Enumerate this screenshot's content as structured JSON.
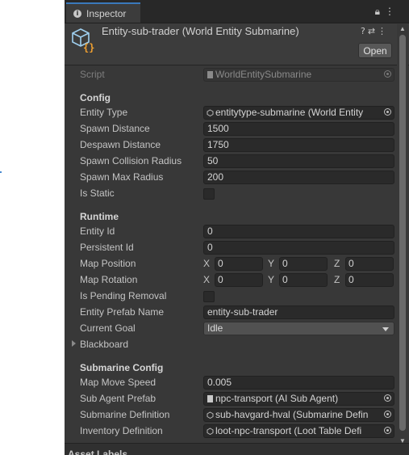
{
  "tab": {
    "label": "Inspector",
    "tools": "🔒 ⋮"
  },
  "header": {
    "title": "Entity-sub-trader (World Entity Submarine)",
    "icons": "❓ ⇄ ⋮",
    "open_button": "Open"
  },
  "script_row": {
    "label": "Script",
    "value": "WorldEntitySubmarine"
  },
  "config": {
    "section": "Config",
    "entity_type": {
      "label": "Entity Type",
      "value": "entitytype-submarine (World Entity"
    },
    "spawn_distance": {
      "label": "Spawn Distance",
      "value": "1500"
    },
    "despawn_distance": {
      "label": "Despawn Distance",
      "value": "1750"
    },
    "spawn_collision_radius": {
      "label": "Spawn Collision Radius",
      "value": "50"
    },
    "spawn_max_radius": {
      "label": "Spawn Max Radius",
      "value": "200"
    },
    "is_static": {
      "label": "Is Static",
      "checked": false
    }
  },
  "runtime": {
    "section": "Runtime",
    "entity_id": {
      "label": "Entity Id",
      "value": "0"
    },
    "persistent_id": {
      "label": "Persistent Id",
      "value": "0"
    },
    "map_position": {
      "label": "Map Position",
      "x_label": "X",
      "y_label": "Y",
      "z_label": "Z",
      "x": "0",
      "y": "0",
      "z": "0"
    },
    "map_rotation": {
      "label": "Map Rotation",
      "x_label": "X",
      "y_label": "Y",
      "z_label": "Z",
      "x": "0",
      "y": "0",
      "z": "0"
    },
    "is_pending_removal": {
      "label": "Is Pending Removal",
      "checked": false
    },
    "entity_prefab_name": {
      "label": "Entity Prefab Name",
      "value": "entity-sub-trader"
    },
    "current_goal": {
      "label": "Current Goal",
      "value": "Idle"
    },
    "blackboard": {
      "label": "Blackboard",
      "expanded": false
    }
  },
  "submarine_config": {
    "section": "Submarine Config",
    "map_move_speed": {
      "label": "Map Move Speed",
      "value": "0.005"
    },
    "sub_agent_prefab": {
      "label": "Sub Agent Prefab",
      "value": "npc-transport (AI Sub Agent)"
    },
    "submarine_definition": {
      "label": "Submarine Definition",
      "value": "sub-havgard-hval (Submarine Defin"
    },
    "inventory_definition": {
      "label": "Inventory Definition",
      "value": "loot-npc-transport (Loot Table Defi"
    }
  },
  "footer": {
    "label": "Asset Labels"
  },
  "colors": {
    "accent": "#3a79bb",
    "panel": "#383838",
    "field": "#2a2a2a",
    "text": "#c4c4c4"
  },
  "icons": [
    "info-icon",
    "lock-icon",
    "menu-icon",
    "cube-script-icon",
    "help-icon",
    "preset-icon",
    "object-picker-icon",
    "script-file-icon",
    "prefab-icon",
    "dropdown-arrow-icon",
    "foldout-arrow-icon"
  ]
}
